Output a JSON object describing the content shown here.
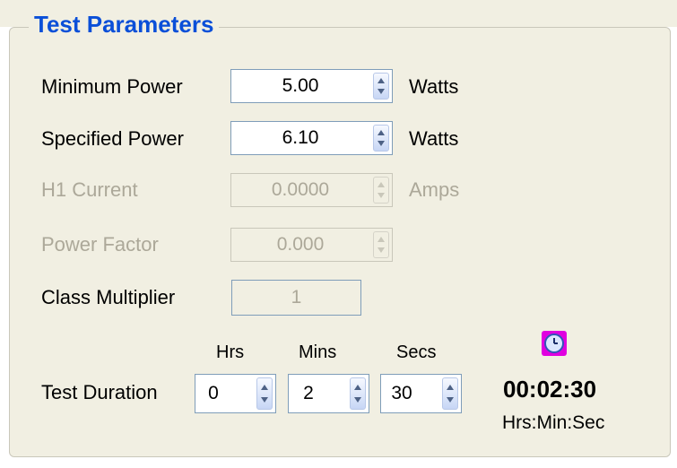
{
  "group": {
    "title": "Test Parameters"
  },
  "fields": {
    "min_power": {
      "label": "Minimum Power",
      "value": "5.00",
      "unit": "Watts",
      "enabled": true
    },
    "spec_power": {
      "label": "Specified Power",
      "value": "6.10",
      "unit": "Watts",
      "enabled": true
    },
    "h1_current": {
      "label": "H1 Current",
      "value": "0.0000",
      "unit": "Amps",
      "enabled": false
    },
    "power_factor": {
      "label": "Power Factor",
      "value": "0.000",
      "enabled": false
    },
    "class_multiplier": {
      "label": "Class Multiplier",
      "value": "1",
      "enabled": false
    }
  },
  "duration": {
    "label": "Test Duration",
    "hrs_label": "Hrs",
    "mins_label": "Mins",
    "secs_label": "Secs",
    "hrs": "0",
    "mins": "2",
    "secs": "30"
  },
  "timer": {
    "display": "00:02:30",
    "format": "Hrs:Min:Sec",
    "icon": "clock-icon"
  },
  "colors": {
    "title": "#0a4fd8",
    "panel_bg": "#f1efe2",
    "disabled_text": "#aca899",
    "input_border": "#7f9db9",
    "clock_bg": "#e000e0"
  }
}
